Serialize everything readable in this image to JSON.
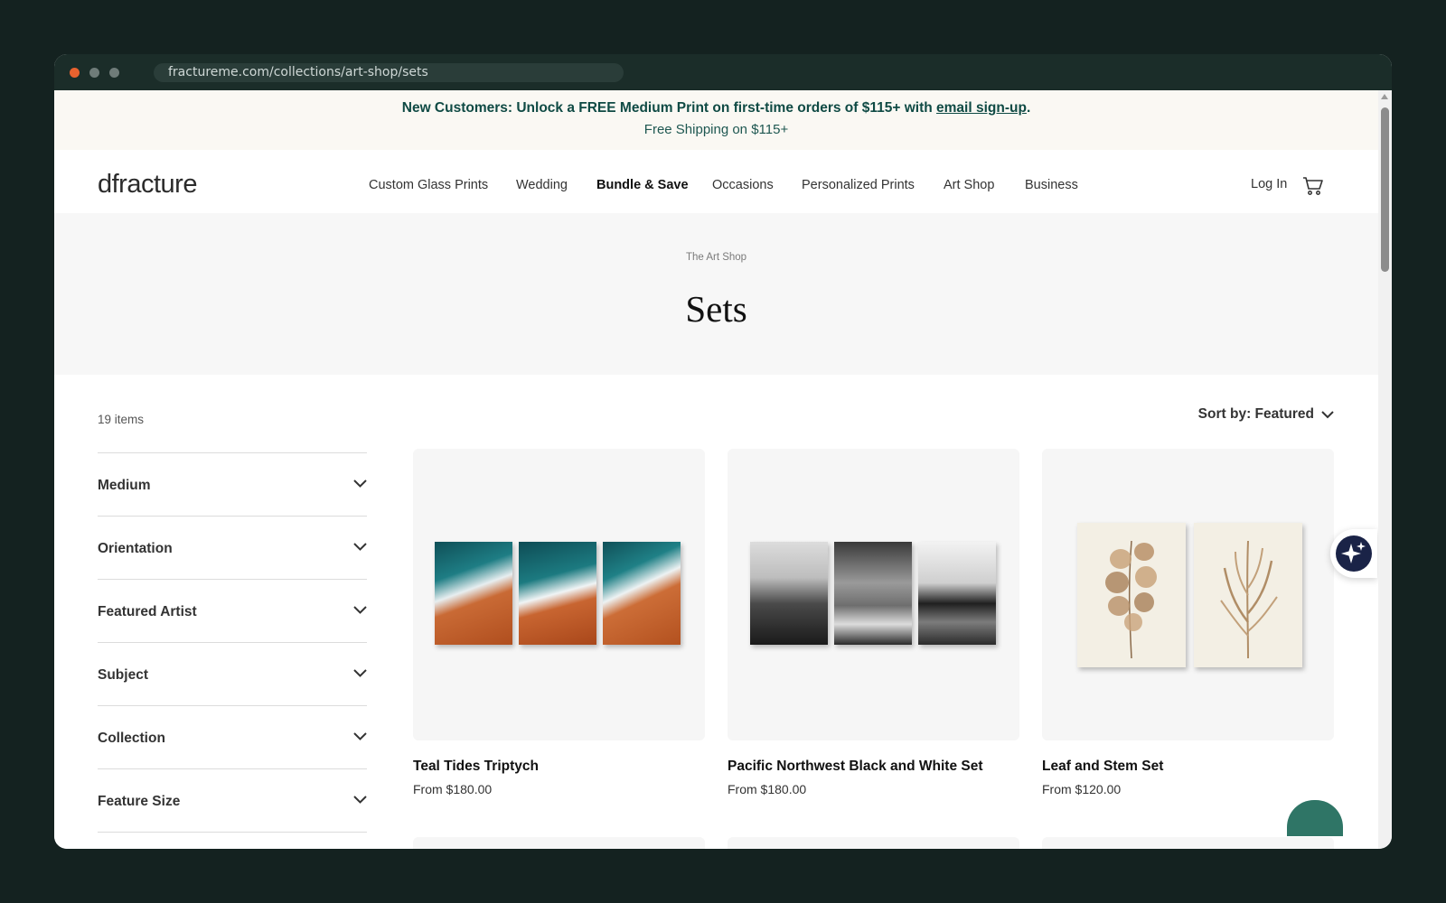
{
  "browser": {
    "url": "fractureme.com/collections/art-shop/sets"
  },
  "promo": {
    "text_before": "New Customers: Unlock a FREE Medium Print on first-time orders of $115+ with ",
    "link": "email sign-up",
    "text_after": ".",
    "shipping": "Free Shipping on $115+"
  },
  "nav": {
    "logo": "dfracture",
    "links": [
      "Custom Glass Prints",
      "Wedding",
      "Bundle & Save",
      "Occasions",
      "Personalized Prints",
      "Art Shop",
      "Business"
    ],
    "login": "Log In"
  },
  "hero": {
    "breadcrumb": "The Art Shop",
    "title": "Sets"
  },
  "listing": {
    "count": "19 items",
    "sort_label": "Sort by: Featured"
  },
  "filters": [
    "Medium",
    "Orientation",
    "Featured Artist",
    "Subject",
    "Collection",
    "Feature Size"
  ],
  "products": [
    {
      "title": "Teal Tides Triptych",
      "price": "From $180.00"
    },
    {
      "title": "Pacific Northwest Black and White Set",
      "price": "From $180.00"
    },
    {
      "title": "Leaf and Stem Set",
      "price": "From $120.00"
    }
  ],
  "icons": {
    "cart": "cart-icon",
    "chevron": "chevron-down-icon",
    "assistant": "sparkle-icon"
  },
  "colors": {
    "promo_text": "#0f4a44",
    "assistant_bg": "#1a2347",
    "chat_bubble": "#2f7566"
  }
}
